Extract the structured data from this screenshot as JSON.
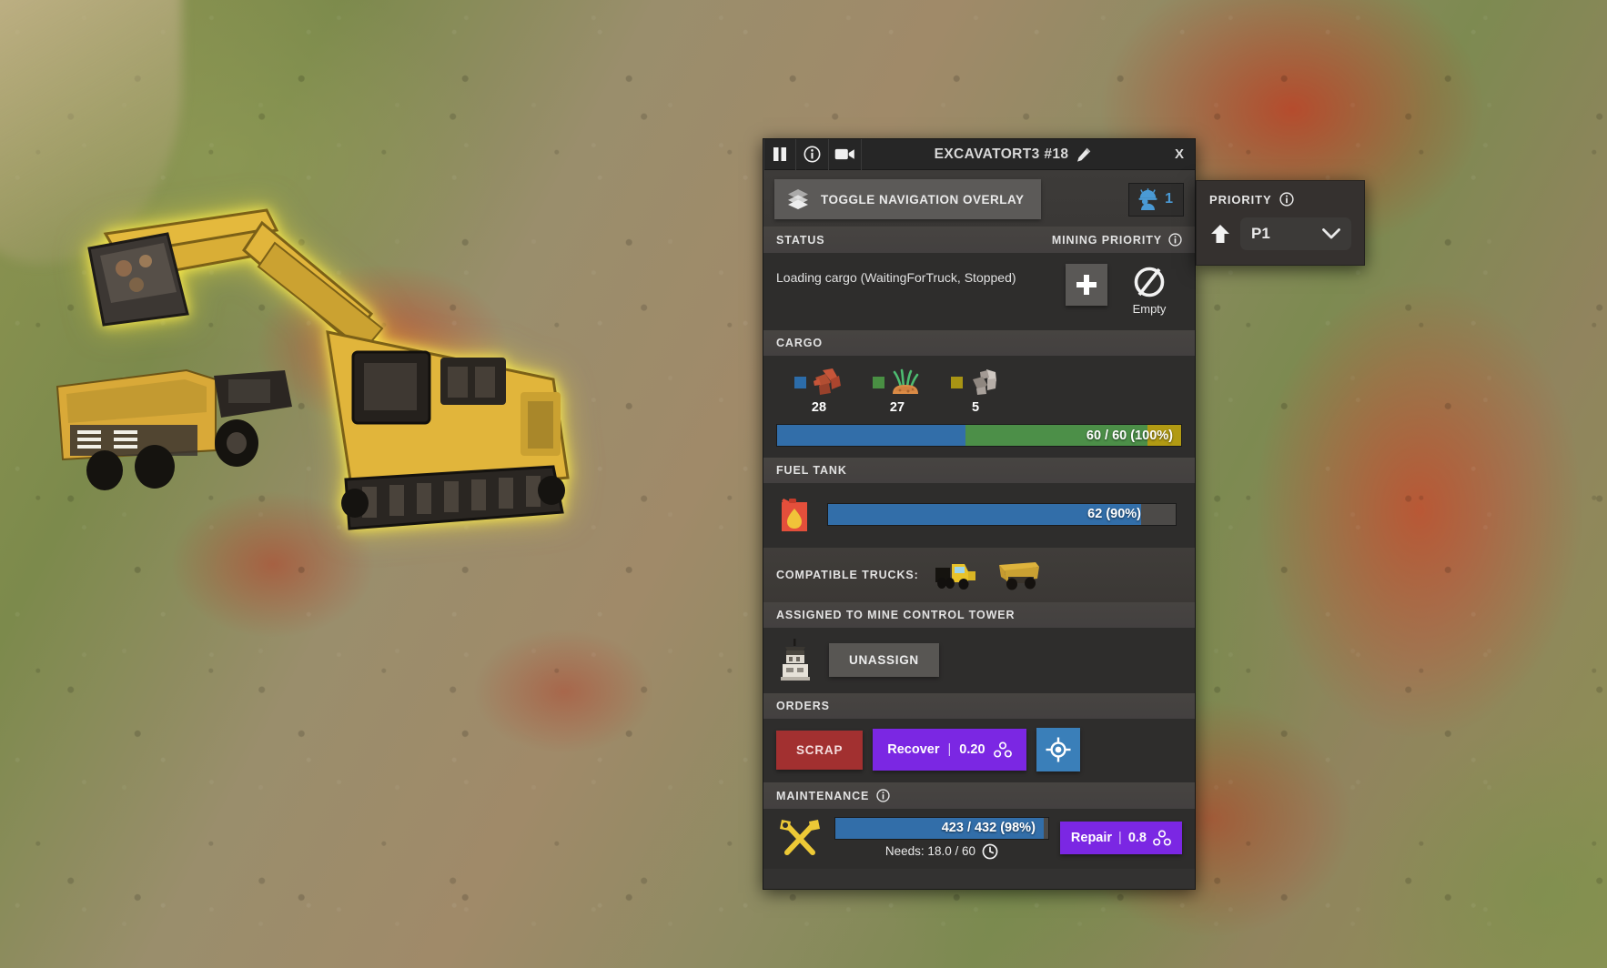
{
  "window": {
    "title": "EXCAVATORT3 #18",
    "close_label": "X",
    "titlebar_icons": [
      "pause-icon",
      "info-icon",
      "camera-icon",
      "edit-pencil-icon"
    ]
  },
  "toolbar": {
    "toggle_nav_label": "TOGGLE NAVIGATION OVERLAY",
    "toggle_nav_icon": "layers-icon",
    "worker_icon": "worker-helmet-icon",
    "worker_count": "1"
  },
  "status": {
    "header": "STATUS",
    "mining_priority_header": "MINING PRIORITY",
    "mining_priority_info_icon": "info-icon",
    "text": "Loading cargo (WaitingForTruck, Stopped)",
    "add_button_icon": "plus-icon",
    "empty_icon": "empty-slash-circle-icon",
    "empty_label": "Empty"
  },
  "cargo": {
    "header": "CARGO",
    "items": [
      {
        "name": "red-ore",
        "icon": "red-ore-icon",
        "swatch": "#2d6ca8",
        "count": "28"
      },
      {
        "name": "dirt",
        "icon": "dirt-grass-icon",
        "swatch": "#4a8f44",
        "count": "27"
      },
      {
        "name": "stone",
        "icon": "gray-rock-icon",
        "swatch": "#a89416",
        "count": "5"
      }
    ],
    "bar": {
      "text": "60 / 60 (100%)",
      "total": 60,
      "segments": [
        {
          "name": "red-ore",
          "value": 28,
          "color": "#336ea8"
        },
        {
          "name": "dirt",
          "value": 27,
          "color": "#4d8f49"
        },
        {
          "name": "stone",
          "value": 5,
          "color": "#b09a16"
        }
      ]
    }
  },
  "fuel": {
    "header": "FUEL TANK",
    "icon": "jerrycan-fuel-icon",
    "bar_text": "62 (90%)",
    "percent": 90
  },
  "compatible_trucks": {
    "label": "COMPATIBLE TRUCKS:",
    "trucks": [
      "semi-truck-icon",
      "dump-truck-icon"
    ]
  },
  "assignment": {
    "header": "ASSIGNED TO MINE CONTROL TOWER",
    "building_icon": "mine-control-tower-icon",
    "unassign_label": "UNASSIGN"
  },
  "orders": {
    "header": "ORDERS",
    "scrap_label": "SCRAP",
    "recover_label": "Recover",
    "recover_separator": "|",
    "recover_value": "0.20",
    "recover_currency_icon": "resource-node-icon",
    "locate_icon": "crosshair-target-icon"
  },
  "maintenance": {
    "header": "MAINTENANCE",
    "info_icon": "info-icon",
    "tools_icon": "wrench-screwdriver-icon",
    "bar_text": "423 / 432 (98%)",
    "percent": 98,
    "needs_label": "Needs: 18.0 / 60",
    "needs_icon": "clock-icon",
    "repair_label": "Repair",
    "repair_separator": "|",
    "repair_value": "0.8",
    "repair_currency_icon": "resource-node-icon"
  },
  "priority": {
    "header": "PRIORITY",
    "info_icon": "info-icon",
    "raise_icon": "up-arrow-icon",
    "selected": "P1",
    "chevron_icon": "chevron-down-icon"
  },
  "colors": {
    "accent_blue": "#336ea8",
    "accent_green": "#4d8f49",
    "accent_yellow": "#b09a16",
    "scrap_red": "#a03030",
    "purple": "#7a28e0",
    "locate_blue": "#3b7fb8",
    "worker_blue": "#4b9ad4"
  }
}
